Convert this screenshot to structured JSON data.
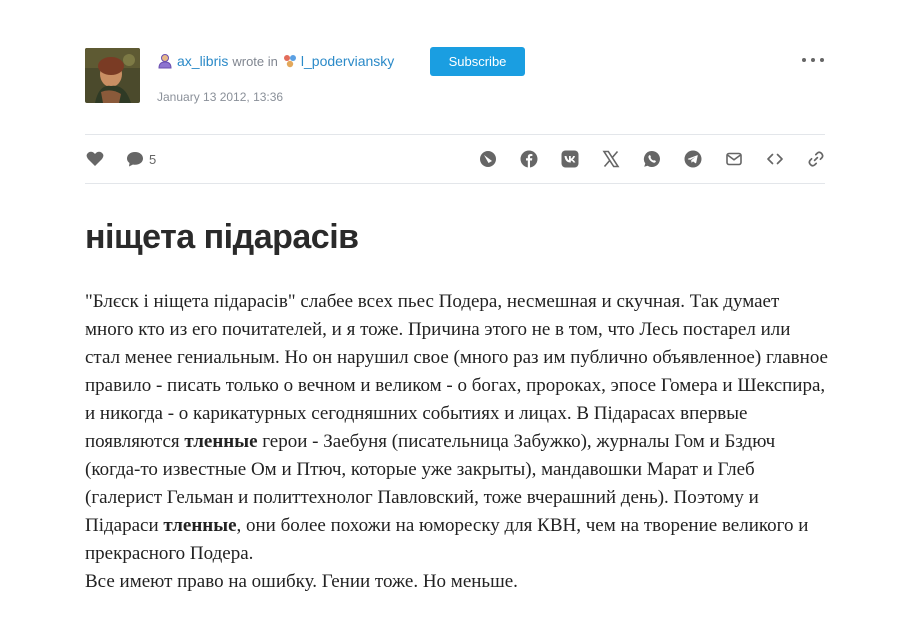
{
  "author": {
    "name": "ax_libris",
    "wrote_in": "wrote in",
    "community": "l_poderviansky"
  },
  "subscribe_label": "Subscribe",
  "date": "January 13 2012, 13:36",
  "comments_count": "5",
  "share_icons": [
    "livejournal-icon",
    "facebook-icon",
    "vk-icon",
    "x-icon",
    "whatsapp-icon",
    "telegram-icon",
    "email-icon",
    "embed-icon",
    "link-icon"
  ],
  "title": "ніщета підарасів",
  "body": {
    "p1a": "\"Блєск і ніщета підарасів\" слабее всех пьес Подера, несмешная и скучная. Так думает много кто из его почитателей, и я тоже. Причина этого не в том, что Лесь постарел или стал менее гениальным. Но он нарушил свое (много раз им публично объявленное) главное правило - писать только о вечном и великом - о богах, пророках, эпосе Гомера и Шекспира, и никогда - о карикатурных сегодняшних событиях и лицах. В Підарасах впервые появляются ",
    "bold1": "тленные",
    "p1b": " герои -  Заебуня (писательница Забужко), журналы Гом и Бздюч (когда-то известные Ом и Птюч, которые уже закрыты), мандавошки Марат и Глеб (галерист Гельман и политтехнолог Павловский, тоже вчерашний день). Поэтому и Підараси ",
    "bold2": "тленные",
    "p1c": ", они более похожи на юмореску для КВН, чем на творение великого и прекрасного Подера.",
    "p2": "Все имеют право на ошибку. Гении тоже. Но меньше."
  },
  "colors": {
    "accent": "#1a9ee1",
    "link": "#2b8ac8",
    "icon": "#555555"
  }
}
